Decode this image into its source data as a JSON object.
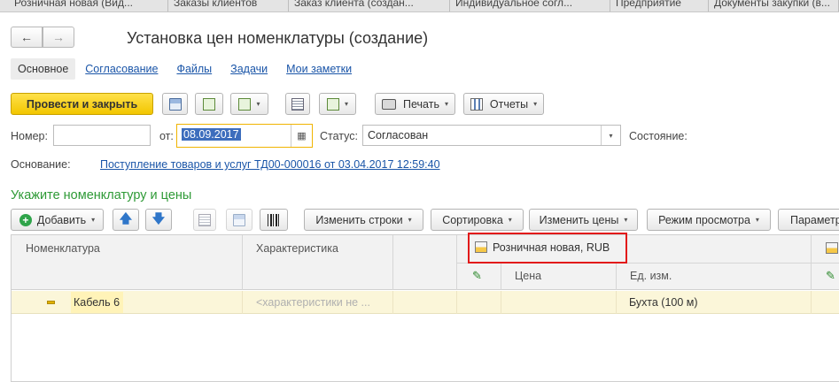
{
  "tabs": [
    {
      "label": "Розничная новая (Вид..."
    },
    {
      "label": "Заказы клиентов"
    },
    {
      "label": "Заказ клиента (создан..."
    },
    {
      "label": "Индивидуальное согл..."
    },
    {
      "label": "Предприятие"
    },
    {
      "label": "Документы закупки (в..."
    }
  ],
  "nav": {
    "back_icon": "←",
    "forward_icon": "→"
  },
  "title": "Установка цен номенклатуры (создание)",
  "section_tabs": [
    "Основное",
    "Согласование",
    "Файлы",
    "Задачи",
    "Мои заметки"
  ],
  "toolbar": {
    "post_close": "Провести и закрыть",
    "print": "Печать",
    "reports": "Отчеты",
    "caret": "▾"
  },
  "form": {
    "number_label": "Номер:",
    "number_value": "",
    "date_label": "от:",
    "date_value": "08.09.2017",
    "status_label": "Статус:",
    "status_value": "Согласован",
    "state_label": "Состояние:",
    "basis_label": "Основание:",
    "basis_link": "Поступление товаров и услуг ТД00-000016 от 03.04.2017 12:59:40",
    "calendar_icon": "▦"
  },
  "section_title": "Укажите номенклатуру и цены",
  "table_toolbar": {
    "add": "Добавить",
    "plus": "+",
    "up": "🡅",
    "down": "🡇",
    "change_rows": "Изменить строки",
    "sort": "Сортировка",
    "change_prices": "Изменить цены",
    "view_mode": "Режим просмотра",
    "params": "Параметр"
  },
  "grid": {
    "col_nomenclature": "Номенклатура",
    "col_characteristic": "Характеристика",
    "price_type": "Розничная новая, RUB",
    "col_price": "Цена",
    "col_unit": "Ед. изм.",
    "pen_icon": "✎",
    "rows": [
      {
        "name": "Кабель 6",
        "characteristic": "<характеристики не ...",
        "unit": "Бухта (100 м)"
      }
    ]
  }
}
